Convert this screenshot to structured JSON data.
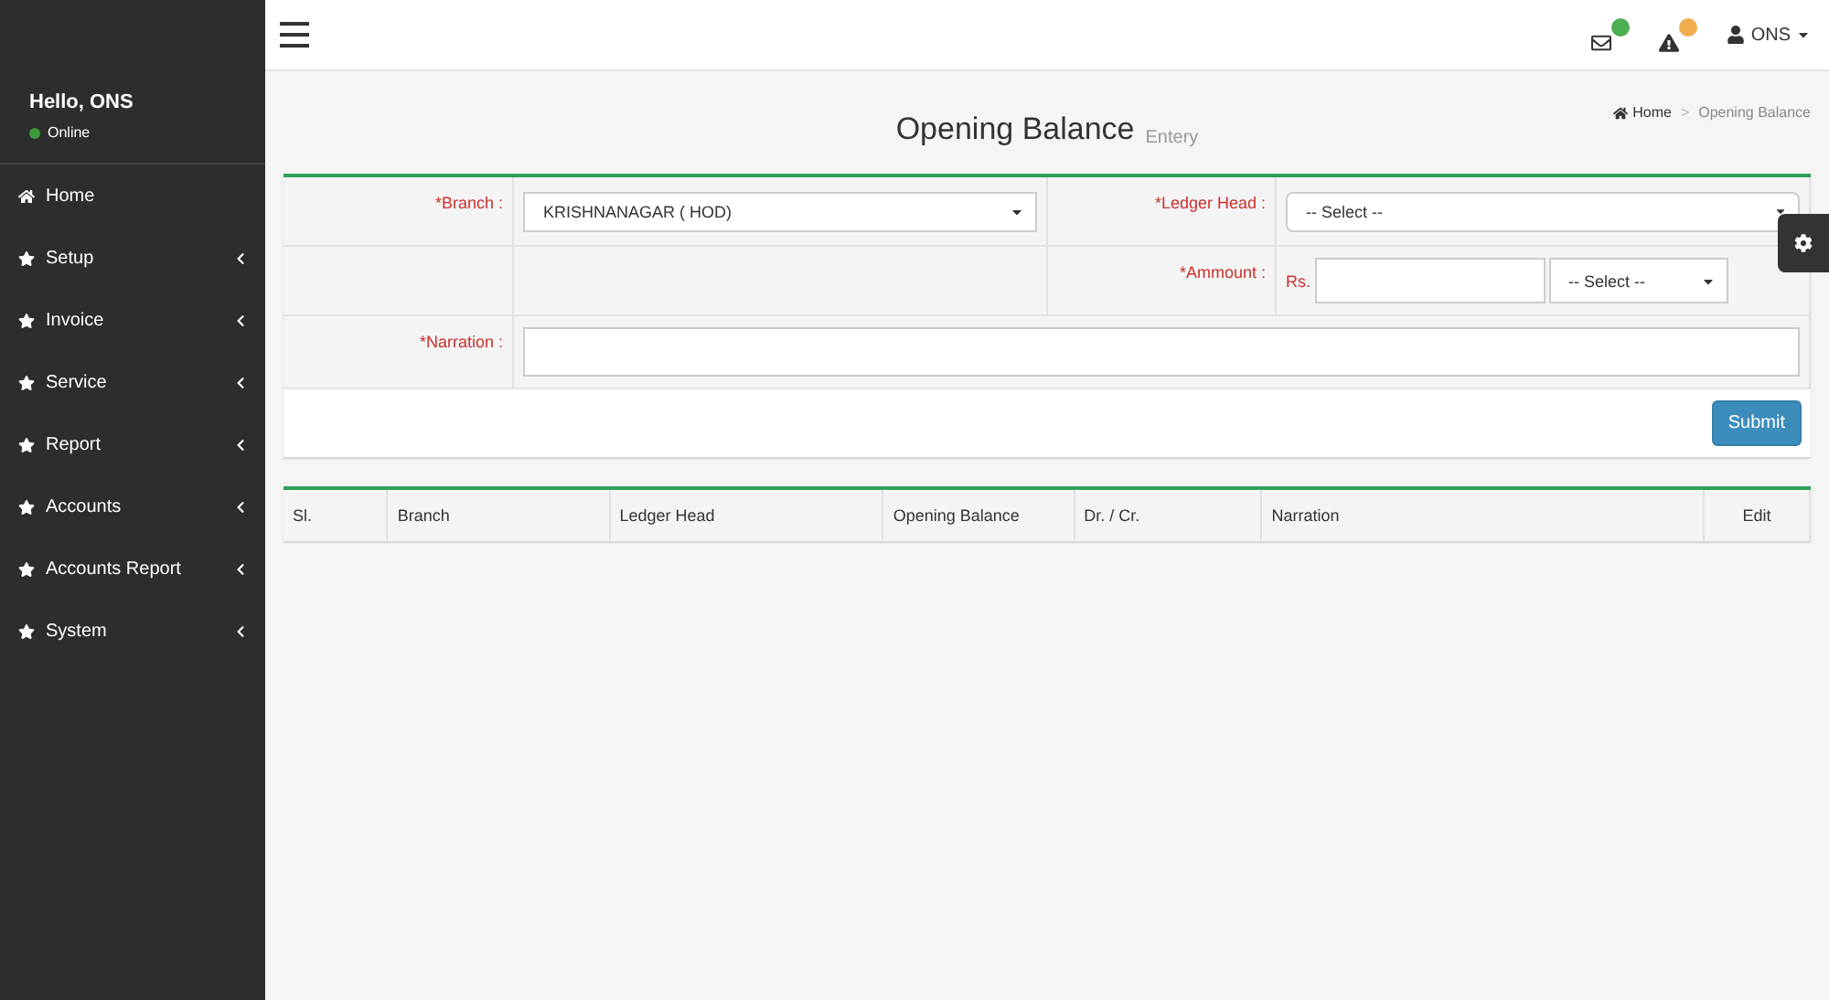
{
  "sidebar": {
    "greeting": "Hello, ONS",
    "status": "Online",
    "items": [
      {
        "label": "Home",
        "kind": "home",
        "expandable": false
      },
      {
        "label": "Setup",
        "kind": "star",
        "expandable": true
      },
      {
        "label": "Invoice",
        "kind": "star",
        "expandable": true
      },
      {
        "label": "Service",
        "kind": "star",
        "expandable": true
      },
      {
        "label": "Report",
        "kind": "star",
        "expandable": true
      },
      {
        "label": "Accounts",
        "kind": "star",
        "expandable": true
      },
      {
        "label": "Accounts Report",
        "kind": "star",
        "expandable": true
      },
      {
        "label": "System",
        "kind": "star",
        "expandable": true
      }
    ]
  },
  "topbar": {
    "notifications": [
      {
        "kind": "mail",
        "color": "#4caf50"
      },
      {
        "kind": "warning",
        "color": "#f0ad4e"
      }
    ],
    "user": "ONS"
  },
  "page": {
    "title": "Opening Balance",
    "subtitle": "Entery",
    "breadcrumb": [
      "Home",
      "Opening Balance"
    ],
    "breadcrumb_separator": ">"
  },
  "form": {
    "branch": {
      "label": "*Branch :",
      "value": "KRISHNANAGAR ( HOD)"
    },
    "ledger_head": {
      "label": "*Ledger Head :",
      "value": "-- Select --"
    },
    "amount": {
      "label": "*Ammount :",
      "prefix": "Rs.",
      "type_value": "-- Select --"
    },
    "narration": {
      "label": "*Narration :"
    },
    "submit": "Submit"
  },
  "table": {
    "columns": [
      "Sl.",
      "Branch",
      "Ledger Head",
      "Opening Balance",
      "Dr. / Cr.",
      "Narration",
      "Edit"
    ]
  }
}
